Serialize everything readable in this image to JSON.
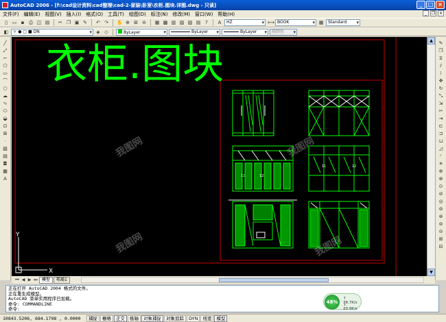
{
  "window": {
    "title": "AutoCAD 2006 - [f:\\cad设计资料\\cad整理\\cad-2-家装\\卧室\\衣柜.图块.详图.dwg - 只读]"
  },
  "menu": [
    "文件(F)",
    "编辑(E)",
    "视图(V)",
    "插入(I)",
    "格式(O)",
    "工具(T)",
    "绘图(D)",
    "标注(N)",
    "修改(M)",
    "窗口(W)",
    "帮助(H)"
  ],
  "toolbar": {
    "textstyle": "HZ",
    "dimstyle": "BOOK",
    "tablestyle": "Standard",
    "layer": "DN",
    "color": "ByLayer",
    "linetype": "ByLayer",
    "lineweight": "ByLayer",
    "plotstyle": "随颜色"
  },
  "drawing": {
    "title": "衣柜.图块",
    "ucs_y": "Y",
    "ucs_x": "X",
    "cell_labels": [
      "11",
      "12",
      "11",
      "12",
      "11",
      "12"
    ],
    "colors": {
      "line": "#00ff00",
      "frame_red": "#cc0000",
      "text": "#00ff00",
      "cyan": "#00ffff",
      "white": "#ffffff",
      "yellow": "#ffff00"
    }
  },
  "tabs": {
    "model": "模型",
    "layout1": "布局1"
  },
  "command": {
    "lines": [
      "正在打开 AutoCAD 2004 格式的文件。",
      "正在重生成模型。",
      "AutoCAD 菜单实用程序已加载。",
      "命令: COMMANDLINE",
      "命令:"
    ]
  },
  "netmeter": {
    "percent": "48%",
    "up": "38.7K/s",
    "down": "20.9K/s"
  },
  "status": {
    "coords": "10843.5206, 684.1798 , 0.0000",
    "toggles": [
      "捕捉",
      "栅格",
      "正交",
      "极轴",
      "对象捕捉",
      "对象追踪",
      "DYN",
      "线宽",
      "模型"
    ]
  },
  "watermark": "我图网"
}
